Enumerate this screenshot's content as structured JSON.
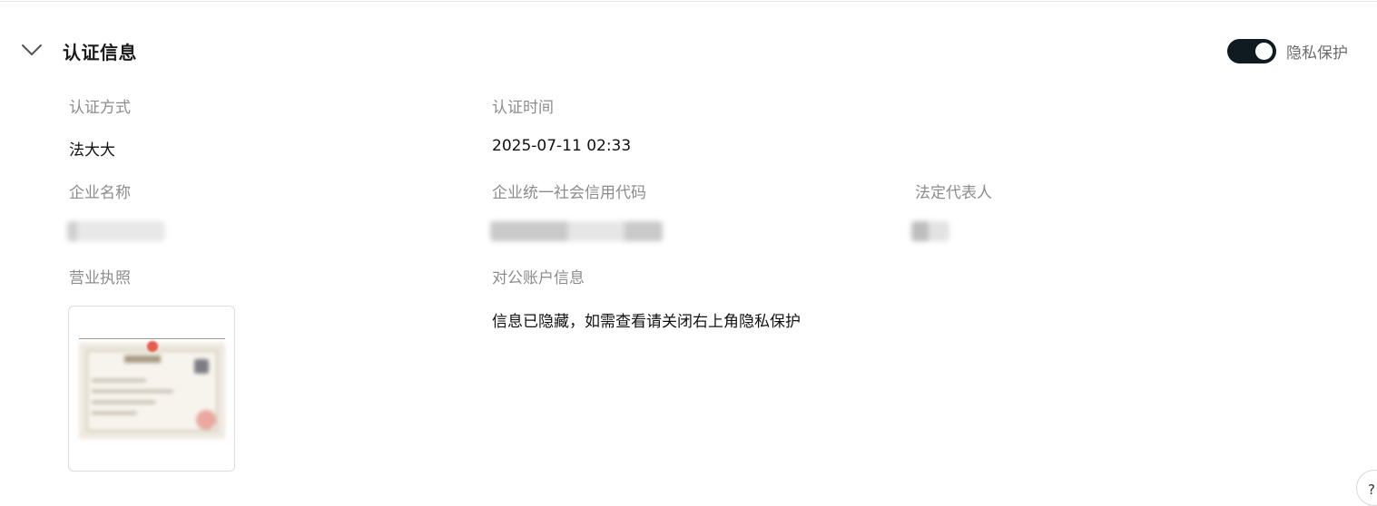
{
  "section": {
    "title": "认证信息",
    "privacy_label": "隐私保护",
    "privacy_enabled": true
  },
  "fields": {
    "auth_method": {
      "label": "认证方式",
      "value": "法大大"
    },
    "auth_time": {
      "label": "认证时间",
      "value": "2025-07-11 02:33"
    },
    "company_name": {
      "label": "企业名称"
    },
    "credit_code": {
      "label": "企业统一社会信用代码"
    },
    "legal_rep": {
      "label": "法定代表人"
    },
    "business_license": {
      "label": "营业执照"
    },
    "corporate_account": {
      "label": "对公账户信息",
      "value": "信息已隐藏，如需查看请关闭右上角隐私保护"
    }
  },
  "help": {
    "glyph": "?"
  }
}
